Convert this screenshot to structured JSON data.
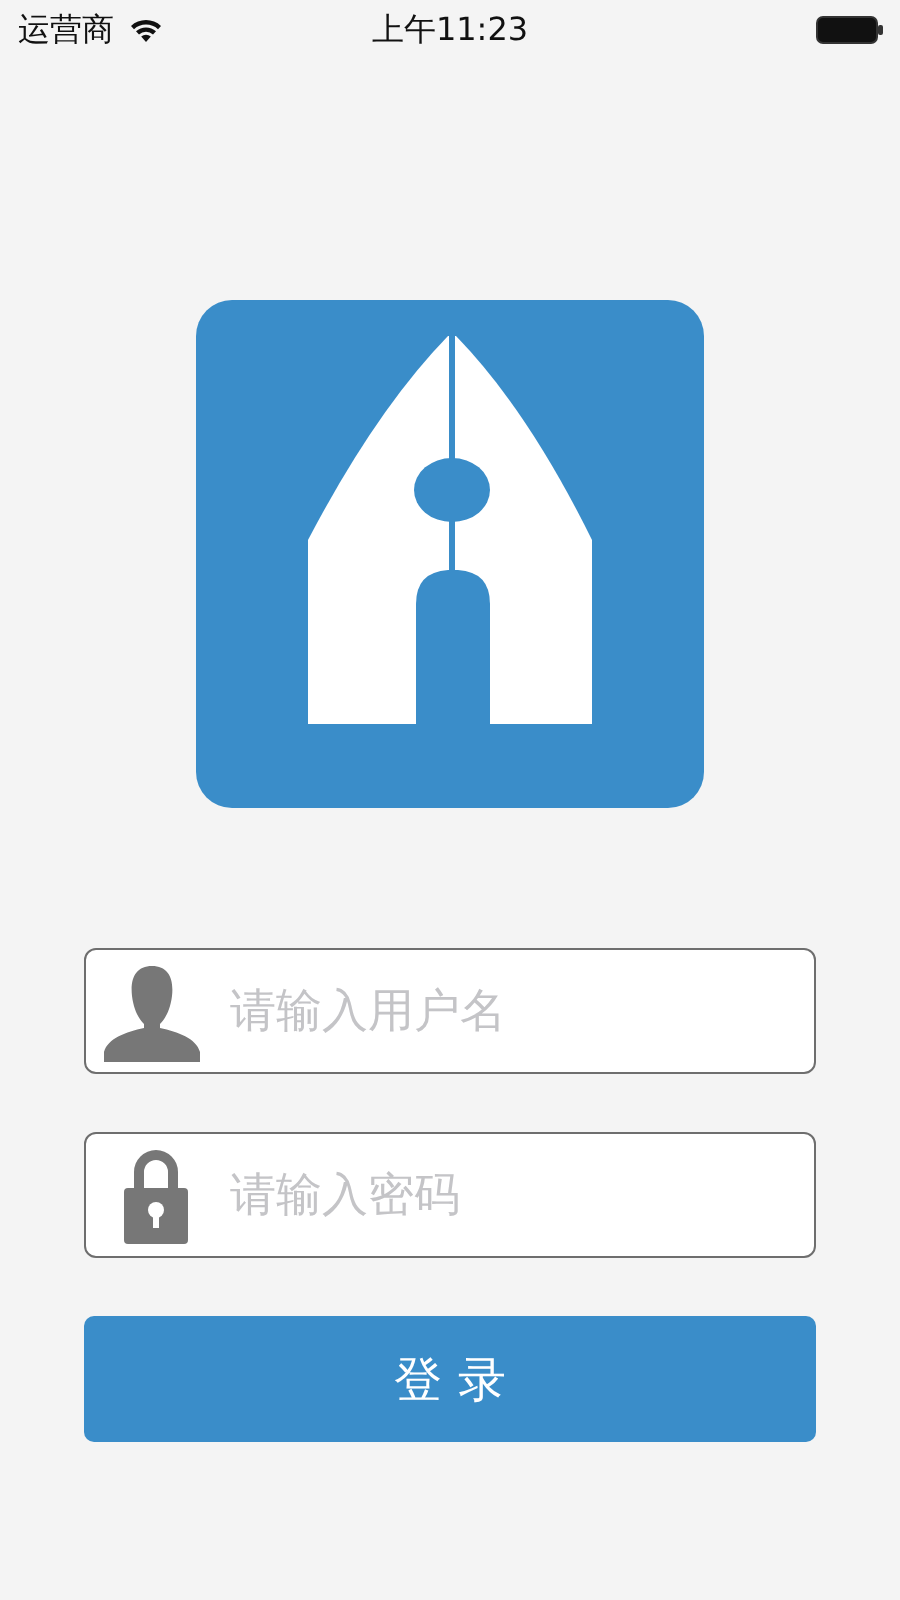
{
  "status_bar": {
    "carrier": "运营商",
    "time": "上午11:23"
  },
  "fields": [
    {
      "kind": "username",
      "placeholder": "请输入用户名"
    },
    {
      "kind": "password",
      "placeholder": "请输入密码"
    }
  ],
  "login_button": {
    "label": "登 录"
  }
}
